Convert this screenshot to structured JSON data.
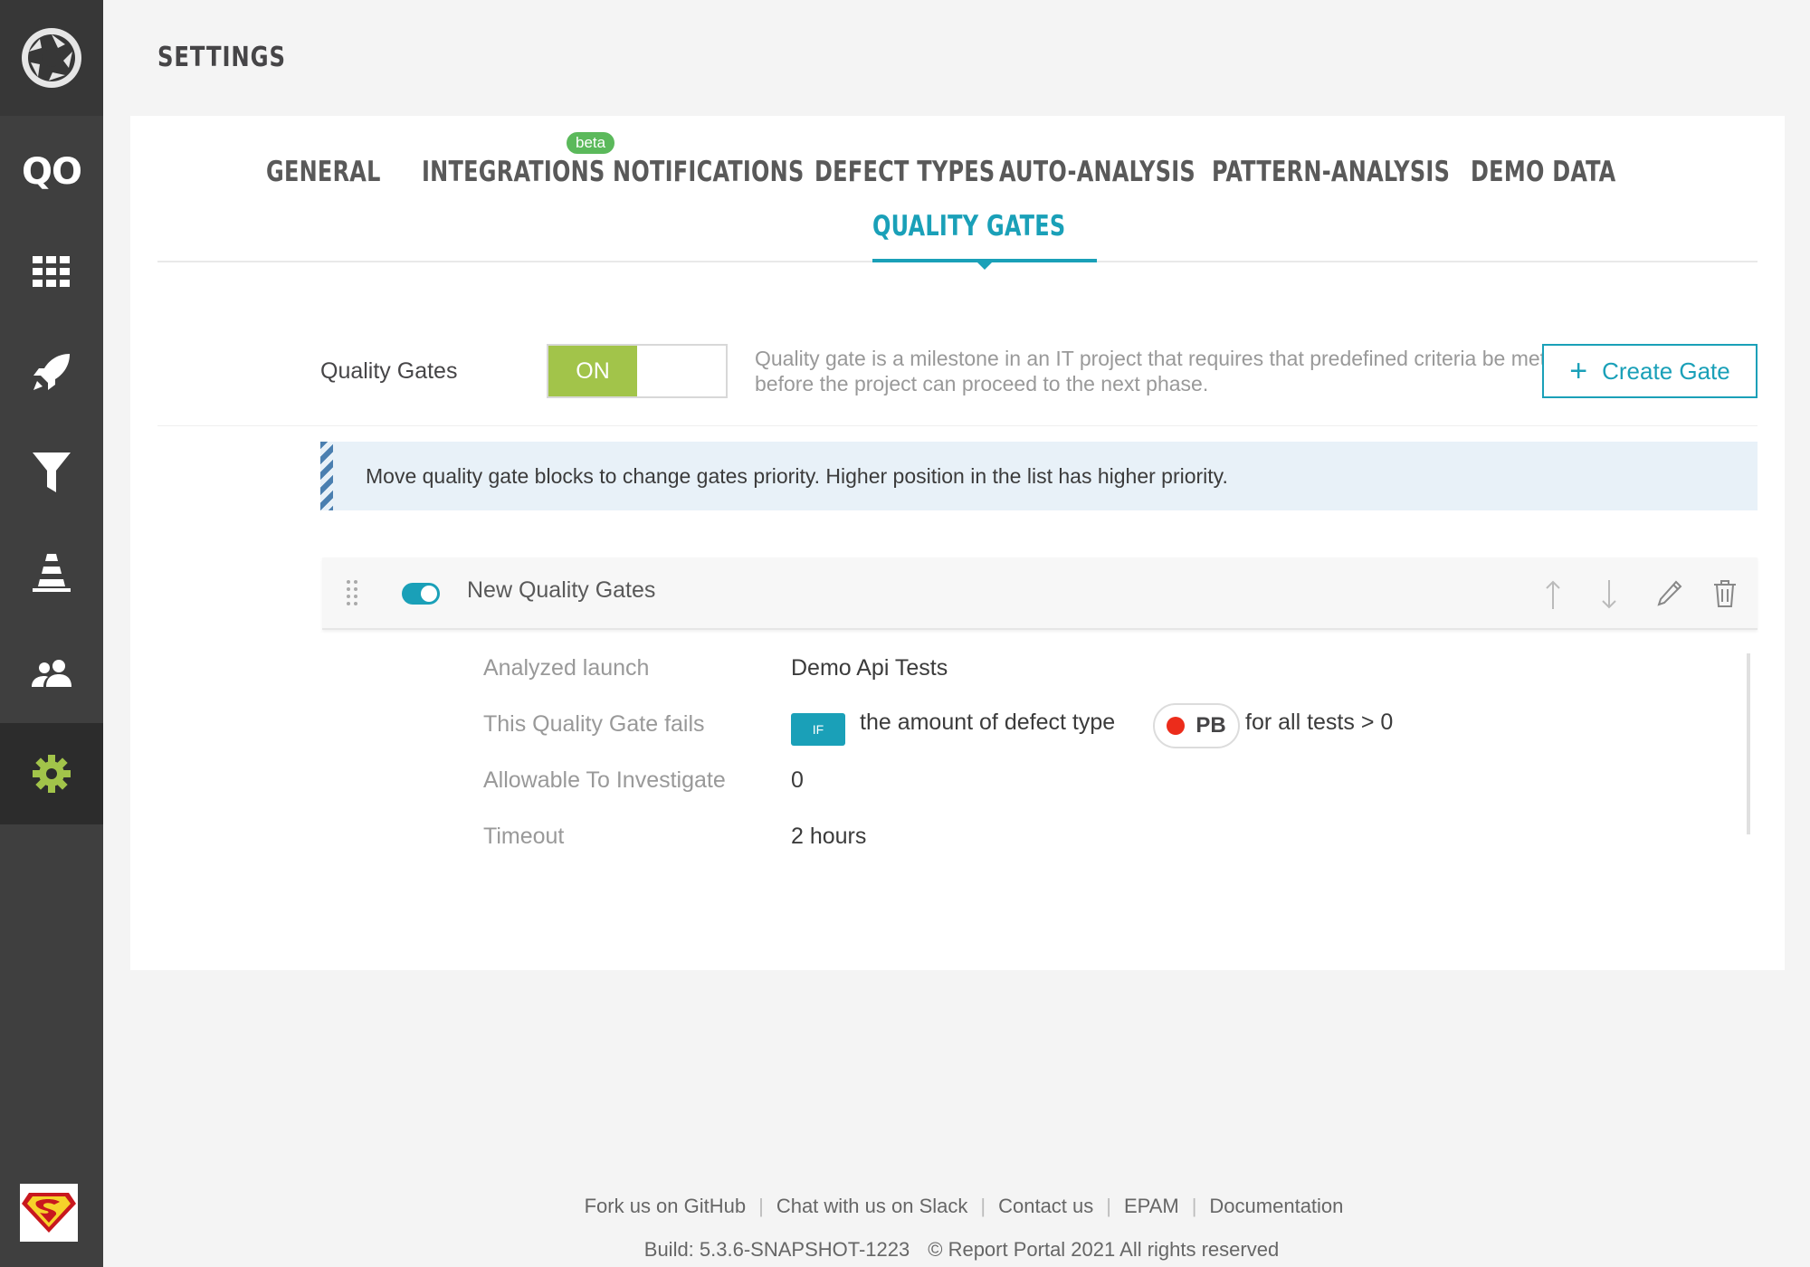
{
  "sidebar": {
    "logo_icon": "report-portal-aperture-icon",
    "project_abbr": "QO",
    "items": [
      {
        "icon": "dashboard-grid-icon"
      },
      {
        "icon": "launches-rocket-icon"
      },
      {
        "icon": "filters-funnel-icon"
      },
      {
        "icon": "debug-cone-icon"
      },
      {
        "icon": "members-people-icon"
      },
      {
        "icon": "settings-gear-icon",
        "active": true
      }
    ],
    "avatar_icon": "superman-avatar-icon",
    "active_color": "#a2c44a"
  },
  "header": {
    "title": "SETTINGS"
  },
  "tabs": {
    "items": [
      "GENERAL",
      "INTEGRATIONS",
      "NOTIFICATIONS",
      "DEFECT TYPES",
      "AUTO-ANALYSIS",
      "PATTERN-ANALYSIS",
      "DEMO DATA",
      "QUALITY GATES"
    ],
    "beta_badge": "beta",
    "active": "QUALITY GATES",
    "accent_color": "#1aa0b8"
  },
  "quality_gates": {
    "label": "Quality Gates",
    "toggle_state": "ON",
    "description": "Quality gate is a milestone in an IT project that requires that predefined criteria be met before the project can proceed to the next phase.",
    "create_button": "Create Gate"
  },
  "info_bar": {
    "text": "Move quality gate blocks to change gates priority. Higher position in the list has higher priority."
  },
  "gate": {
    "name": "New Quality Gates",
    "enabled": true,
    "actions": [
      "move-up-icon",
      "move-down-icon",
      "edit-pencil-icon",
      "delete-trash-icon"
    ],
    "details": {
      "analyzed_launch_label": "Analyzed launch",
      "analyzed_launch_value": "Demo Api Tests",
      "fails_label": "This Quality Gate fails",
      "if_badge": "IF",
      "cond_prefix": "the amount of defect type",
      "defect_type": "PB",
      "defect_color": "#ec2c1b",
      "cond_suffix": "for all tests > 0",
      "allowable_label": "Allowable To Investigate",
      "allowable_value": "0",
      "timeout_label": "Timeout",
      "timeout_value": "2 hours"
    }
  },
  "footer": {
    "links": [
      "Fork us on GitHub",
      "Chat with us on Slack",
      "Contact us",
      "EPAM",
      "Documentation"
    ],
    "build": "Build: 5.3.6-SNAPSHOT-1223",
    "copyright": "© Report Portal 2021 All rights reserved"
  }
}
